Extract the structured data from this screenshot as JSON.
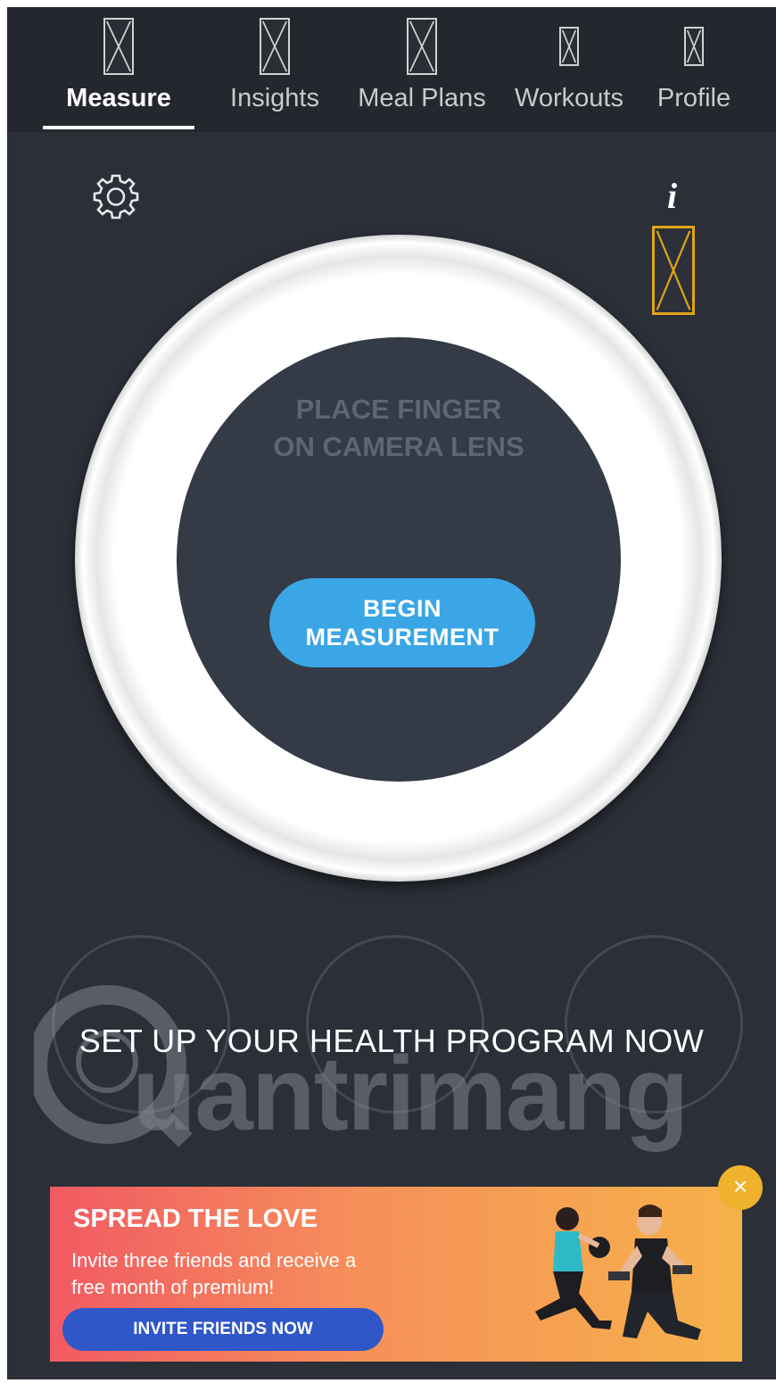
{
  "nav": {
    "tabs": [
      {
        "label": "Measure",
        "icon": "measure-icon",
        "active": true
      },
      {
        "label": "Insights",
        "icon": "insights-icon",
        "active": false
      },
      {
        "label": "Meal Plans",
        "icon": "meal-plans-icon",
        "active": false
      },
      {
        "label": "Workouts",
        "icon": "workouts-icon",
        "active": false
      },
      {
        "label": "Profile",
        "icon": "profile-icon",
        "active": false
      }
    ]
  },
  "measure": {
    "settings_icon": "gear-icon",
    "info_label": "i",
    "instruction": "PLACE FINGER ON CAMERA LENS",
    "instruction_line1": "PLACE FINGER",
    "instruction_line2": "ON CAMERA LENS",
    "begin_line1": "BEGIN",
    "begin_line2": "MEASUREMENT"
  },
  "program": {
    "setup_text": "SET UP YOUR HEALTH PROGRAM NOW"
  },
  "watermark": {
    "text": "uantrimang"
  },
  "banner": {
    "title": "SPREAD THE LOVE",
    "text_line1": "Invite three friends and receive a",
    "text_line2": "free month of premium!",
    "button": "INVITE FRIENDS NOW",
    "close_symbol": "×"
  },
  "colors": {
    "background": "#2b2f37",
    "button_blue": "#3aa6e6",
    "banner_button": "#2f57c8",
    "accent_yellow": "#e0a418"
  }
}
